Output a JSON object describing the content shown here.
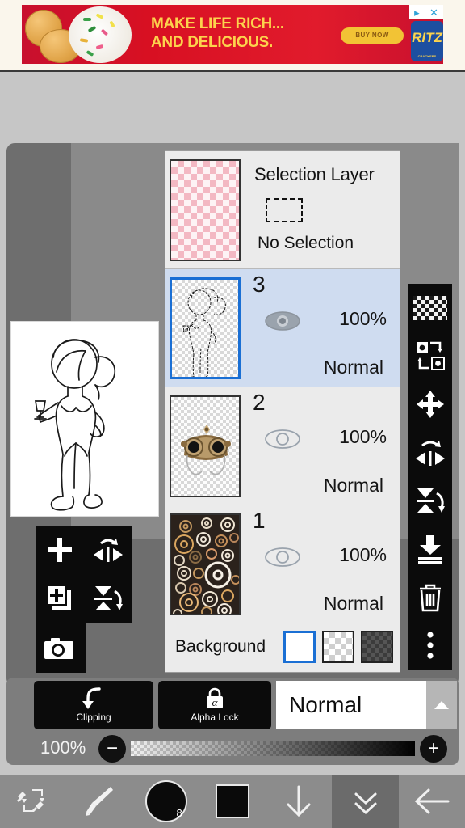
{
  "ad": {
    "headline_line1": "MAKE LIFE RICH...",
    "headline_line2": "AND DELICIOUS.",
    "cta_label": "BUY NOW",
    "brand": "RITZ",
    "brand_sub": "CRACKERS",
    "close_glyph": "✕",
    "info_glyph": "▸",
    "colors": {
      "bg": "#c8102e",
      "text": "#fcd34d",
      "cta": "#f2c335",
      "logo": "#1d4fa0"
    }
  },
  "layers_panel": {
    "selection_layer": {
      "title": "Selection Layer",
      "status": "No Selection",
      "thumbnail": "pink-checker-thumbnail",
      "marquee_icon": "dashed-rectangle-icon"
    },
    "layers": [
      {
        "name": "3",
        "opacity": "100%",
        "blend_mode": "Normal",
        "selected": true,
        "visible": true,
        "visibility_icon": "eye-filled-icon",
        "thumbnail": "character-lineart-thumbnail"
      },
      {
        "name": "2",
        "opacity": "100%",
        "blend_mode": "Normal",
        "selected": false,
        "visible": false,
        "visibility_icon": "eye-outline-icon",
        "thumbnail": "steampunk-goggles-thumbnail"
      },
      {
        "name": "1",
        "opacity": "100%",
        "blend_mode": "Normal",
        "selected": false,
        "visible": false,
        "visibility_icon": "eye-outline-icon",
        "thumbnail": "gears-pattern-thumbnail"
      }
    ],
    "background": {
      "label": "Background",
      "swatches": [
        {
          "name": "white",
          "selected": true
        },
        {
          "name": "light-transparent-checker",
          "selected": false
        },
        {
          "name": "dark-transparent-checker",
          "selected": false
        }
      ]
    }
  },
  "right_toolbar": {
    "items": [
      {
        "name": "transparency-checker-button",
        "icon": "checkerboard-icon"
      },
      {
        "name": "swap-layers-button",
        "icon": "swap-layers-icon"
      },
      {
        "name": "move-layer-button",
        "icon": "move-arrows-icon"
      },
      {
        "name": "flip-horizontal-button",
        "icon": "flip-horizontal-icon"
      },
      {
        "name": "flip-vertical-button",
        "icon": "flip-vertical-icon"
      },
      {
        "name": "merge-down-button",
        "icon": "merge-down-icon"
      },
      {
        "name": "delete-layer-button",
        "icon": "trash-icon"
      },
      {
        "name": "more-options-button",
        "icon": "three-dots-vertical-icon"
      }
    ]
  },
  "left_toolbar": {
    "items": [
      {
        "name": "add-layer-button",
        "icon": "plus-icon"
      },
      {
        "name": "flip-horizontal-button",
        "icon": "flip-horizontal-icon"
      },
      {
        "name": "duplicate-layer-button",
        "icon": "copy-plus-icon"
      },
      {
        "name": "flip-vertical-button",
        "icon": "flip-vertical-icon"
      },
      {
        "name": "camera-import-button",
        "icon": "camera-icon"
      }
    ]
  },
  "bottom_controls": {
    "clipping_label": "Clipping",
    "clipping_icon": "arrow-down-hook-icon",
    "alpha_lock_label": "Alpha Lock",
    "alpha_lock_icon": "alpha-padlock-icon",
    "blend_mode_value": "Normal",
    "blend_mode_arrow": "triangle-up-icon",
    "opacity_value": "100%",
    "minus_label": "−",
    "plus_label": "+",
    "slider_position_percent": 100
  },
  "bottom_nav": {
    "items": [
      {
        "name": "brush-eraser-swap-button",
        "icon": "brush-eraser-swap-icon",
        "active": false
      },
      {
        "name": "brush-tool-button",
        "icon": "paintbrush-icon",
        "active": false
      },
      {
        "name": "brush-size-button",
        "icon": "filled-circle-icon",
        "value": "8",
        "active": false
      },
      {
        "name": "color-picker-button",
        "icon": "color-square-icon",
        "active": false
      },
      {
        "name": "download-button",
        "icon": "arrow-down-icon",
        "active": false
      },
      {
        "name": "collapse-panel-button",
        "icon": "double-chevron-down-icon",
        "active": true
      },
      {
        "name": "back-button",
        "icon": "arrow-left-icon",
        "active": false
      }
    ]
  },
  "canvas": {
    "artwork_name": "character-lineart-base",
    "background_color": "#ffffff"
  }
}
